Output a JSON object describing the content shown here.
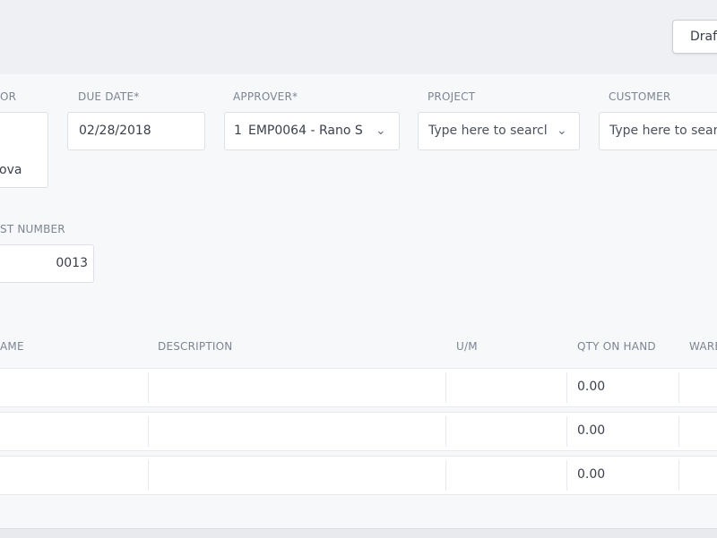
{
  "toolbar": {
    "draft_label": "Draft"
  },
  "form": {
    "vendor": {
      "label": "OR",
      "value": "ova"
    },
    "due_date": {
      "label": "DUE DATE*",
      "value": "02/28/2018"
    },
    "approver": {
      "label": "APPROVER*",
      "count": "1",
      "value": "EMP0064 - Rano S"
    },
    "project": {
      "label": "PROJECT",
      "placeholder": "Type here to searcl"
    },
    "customer": {
      "label": "CUSTOMER",
      "placeholder": "Type here to sear"
    },
    "request_number": {
      "label": "ST NUMBER",
      "value": "0013"
    }
  },
  "table": {
    "headers": [
      "AME",
      "DESCRIPTION",
      "U/M",
      "QTY ON HAND",
      "WARE"
    ],
    "rows": [
      {
        "qty_on_hand": "0.00"
      },
      {
        "qty_on_hand": "0.00"
      },
      {
        "qty_on_hand": "0.00"
      }
    ]
  },
  "icons": {
    "dropdown": "chevron-down-icon"
  }
}
